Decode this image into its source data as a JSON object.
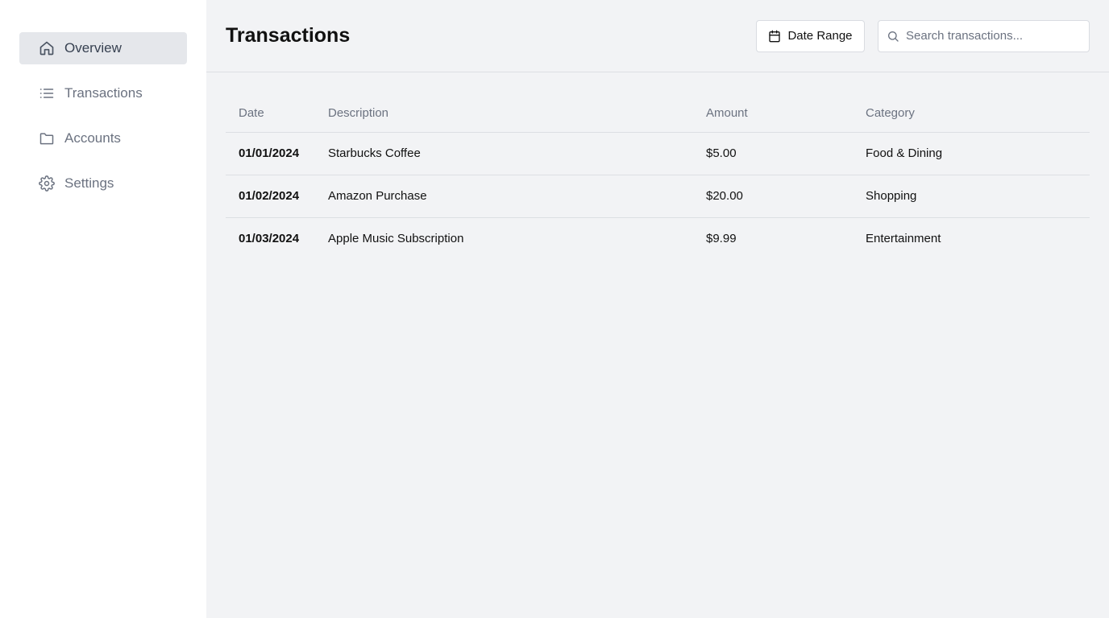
{
  "sidebar": {
    "items": [
      {
        "label": "Overview",
        "icon": "home-icon",
        "active": true
      },
      {
        "label": "Transactions",
        "icon": "list-icon",
        "active": false
      },
      {
        "label": "Accounts",
        "icon": "folder-icon",
        "active": false
      },
      {
        "label": "Settings",
        "icon": "gear-icon",
        "active": false
      }
    ]
  },
  "header": {
    "title": "Transactions",
    "date_range_label": "Date Range",
    "search_placeholder": "Search transactions..."
  },
  "table": {
    "columns": [
      "Date",
      "Description",
      "Amount",
      "Category"
    ],
    "rows": [
      {
        "date": "01/01/2024",
        "description": "Starbucks Coffee",
        "amount": "$5.00",
        "category": "Food & Dining"
      },
      {
        "date": "01/02/2024",
        "description": "Amazon Purchase",
        "amount": "$20.00",
        "category": "Shopping"
      },
      {
        "date": "01/03/2024",
        "description": "Apple Music Subscription",
        "amount": "$9.99",
        "category": "Entertainment"
      }
    ]
  },
  "colors": {
    "sidebar_bg": "#ffffff",
    "main_bg": "#f2f3f5",
    "active_item_bg": "#e5e7eb",
    "muted_text": "#6b7280"
  }
}
